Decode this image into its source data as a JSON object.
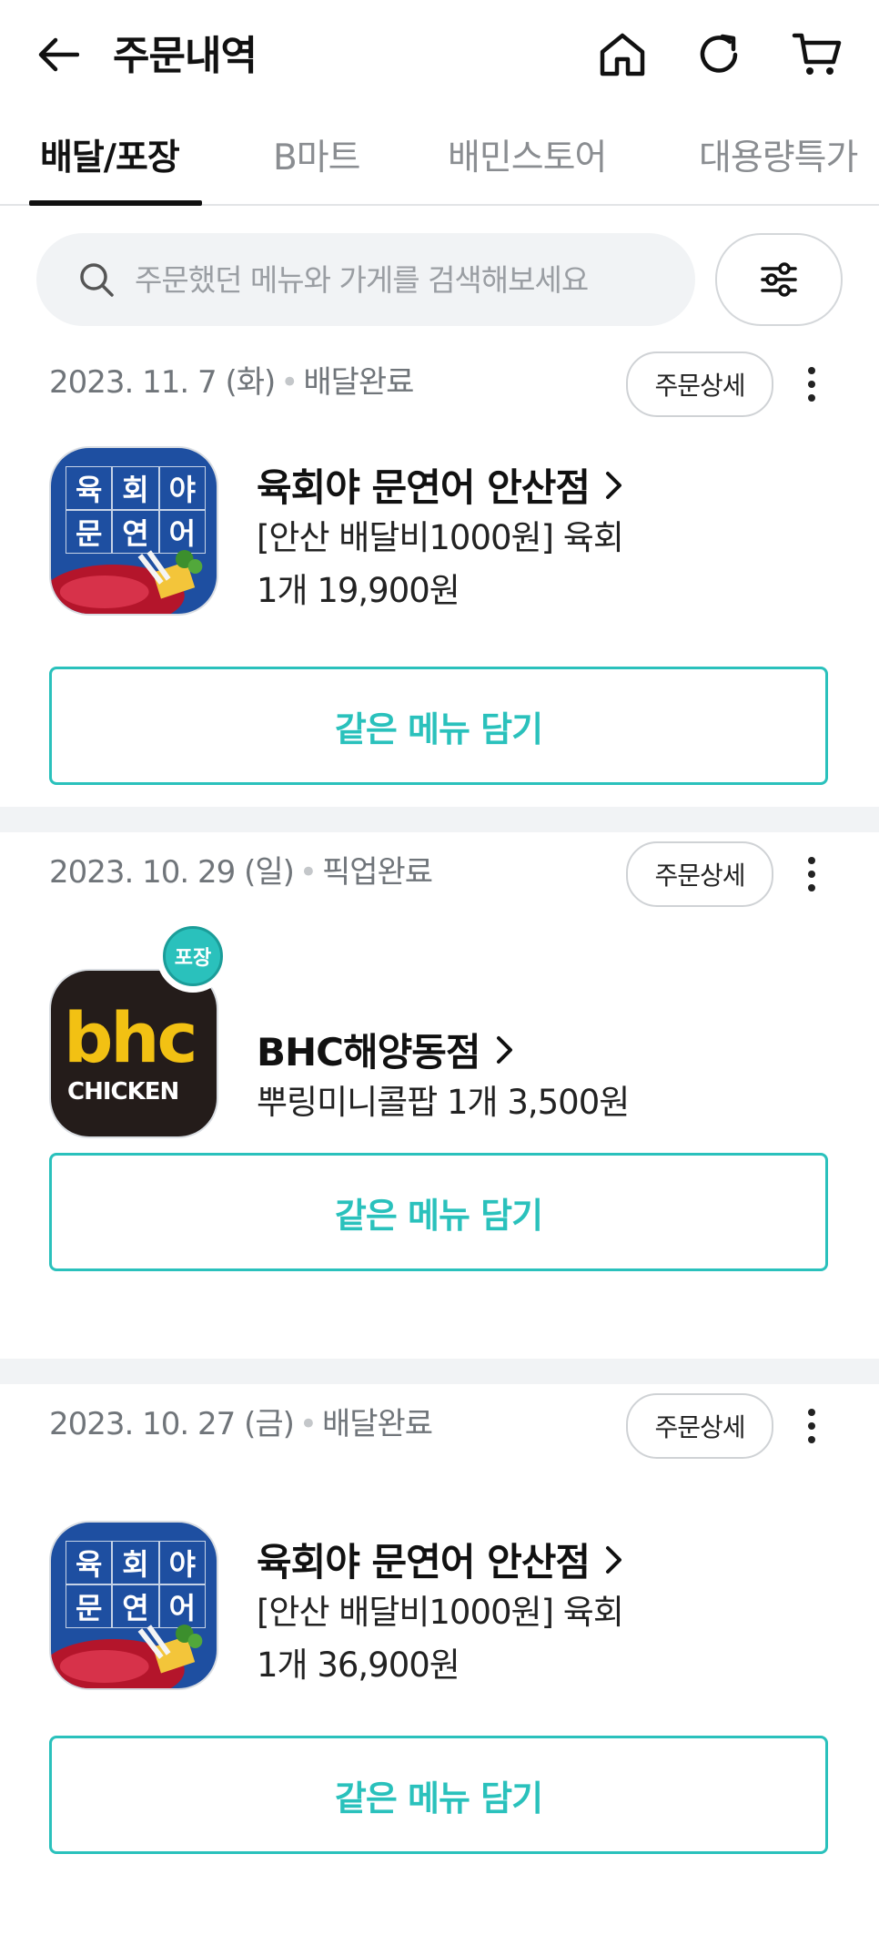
{
  "header": {
    "title": "주문내역"
  },
  "tabs": [
    {
      "label": "배달/포장",
      "active": true
    },
    {
      "label": "B마트",
      "active": false
    },
    {
      "label": "배민스토어",
      "active": false
    },
    {
      "label": "대용량특가",
      "active": false
    }
  ],
  "search": {
    "placeholder": "주문했던 메뉴와 가게를 검색해보세요",
    "value": ""
  },
  "orders": [
    {
      "date": "2023. 11. 7 (화)",
      "status": "배달완료",
      "detail_label": "주문상세",
      "store": "육회야 문연어 안산점",
      "menu_line1": "[안산 배달비1000원] 육회",
      "menu_line2": "1개 19,900원",
      "reorder_label": "같은 메뉴 담기"
    },
    {
      "date": "2023. 10. 29 (일)",
      "status": "픽업완료",
      "detail_label": "주문상세",
      "store": "BHC해양동점",
      "menu_line1": "뿌링미니콜팝 1개 3,500원",
      "badge": "포장",
      "reorder_label": "같은 메뉴 담기"
    },
    {
      "date": "2023. 10. 27 (금)",
      "status": "배달완료",
      "detail_label": "주문상세",
      "store": "육회야 문연어 안산점",
      "menu_line1": "[안산 배달비1000원] 육회",
      "menu_line2": "1개 36,900원",
      "reorder_label": "같은 메뉴 담기"
    }
  ],
  "logos": {
    "yukhoe": [
      "육",
      "회",
      "야",
      "문",
      "연",
      "어"
    ],
    "bhc_word": "bhc",
    "bhc_sub": "CHICKEN"
  },
  "colors": {
    "accent": "#2ac1bc",
    "bhc_yellow": "#f2c113",
    "yukhoe_blue": "#1e4fa1"
  }
}
